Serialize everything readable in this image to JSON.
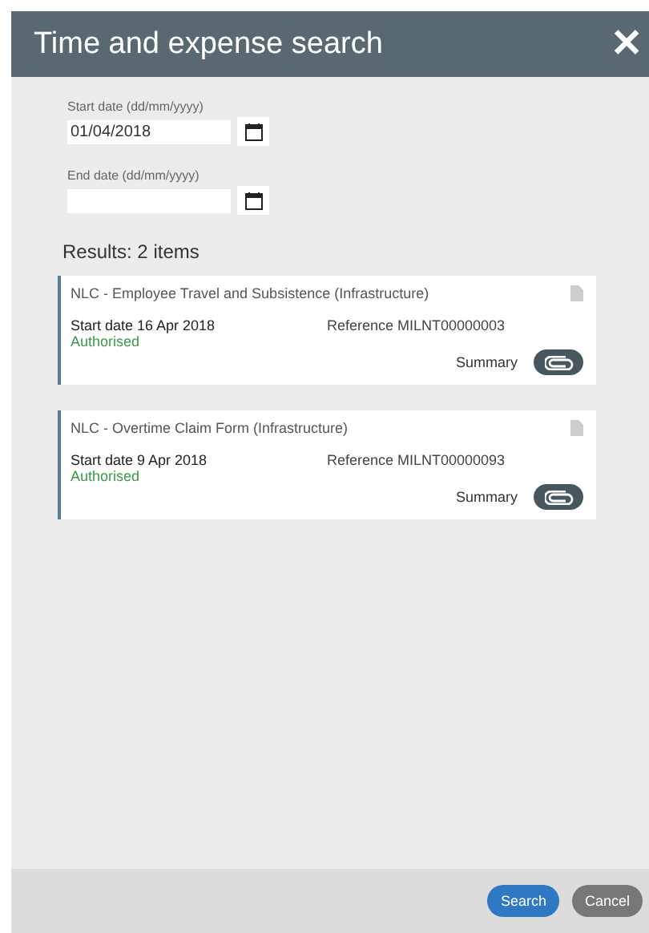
{
  "window": {
    "title": "Time and expense search",
    "close": "✕"
  },
  "fields": [
    {
      "label": "Start date (dd/mm/yyyy)",
      "value": "01/04/2018"
    },
    {
      "label": "End date (dd/mm/yyyy)"
    }
  ],
  "results_heading": "Results: 2 items",
  "results": [
    {
      "title": "NLC - Employee Travel and Subsistence (Infrastructure)",
      "start_date": "Start date 16 Apr 2018",
      "reference": "Reference MILNT00000003",
      "status": "Authorised",
      "summary": "Summary"
    },
    {
      "title": "NLC - Overtime Claim Form (Infrastructure)",
      "start_date": "Start date 9 Apr 2018",
      "reference": "Reference MILNT00000093",
      "status": "Authorised",
      "summary": "Summary"
    }
  ],
  "buttons": [
    {
      "label": "Search",
      "kind": "primary"
    },
    {
      "label": "Cancel",
      "kind": "secondary"
    }
  ]
}
